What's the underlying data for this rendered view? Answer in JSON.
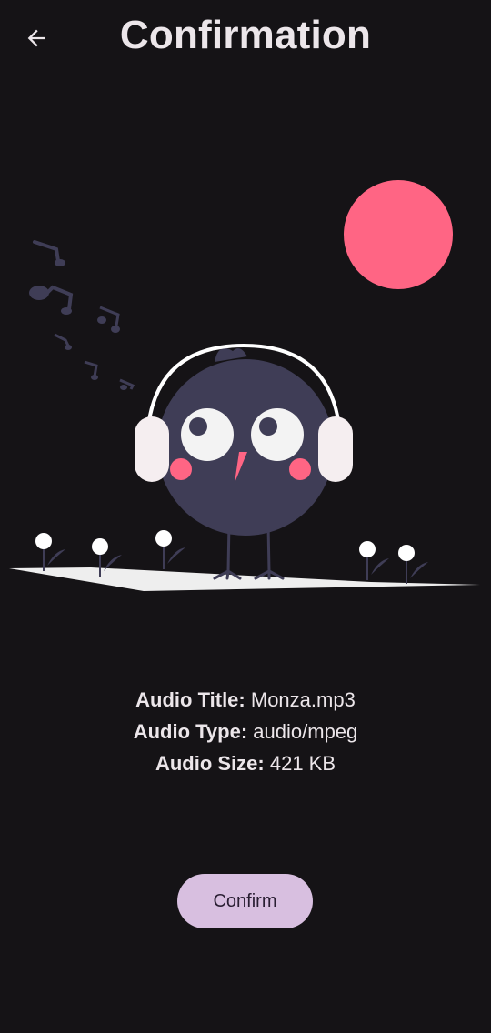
{
  "header": {
    "title": "Confirmation",
    "back_icon": "arrow-back-icon"
  },
  "audio": {
    "title_label": "Audio Title:",
    "title_value": "Monza.mp3",
    "type_label": "Audio Type:",
    "type_value": "audio/mpeg",
    "size_label": "Audio Size:",
    "size_value": "421 KB"
  },
  "actions": {
    "confirm_label": "Confirm"
  },
  "colors": {
    "background": "#151316",
    "text": "#ece6ea",
    "sun": "#ff6584",
    "bird": "#3f3d56",
    "button_bg": "#d8bfe0"
  }
}
